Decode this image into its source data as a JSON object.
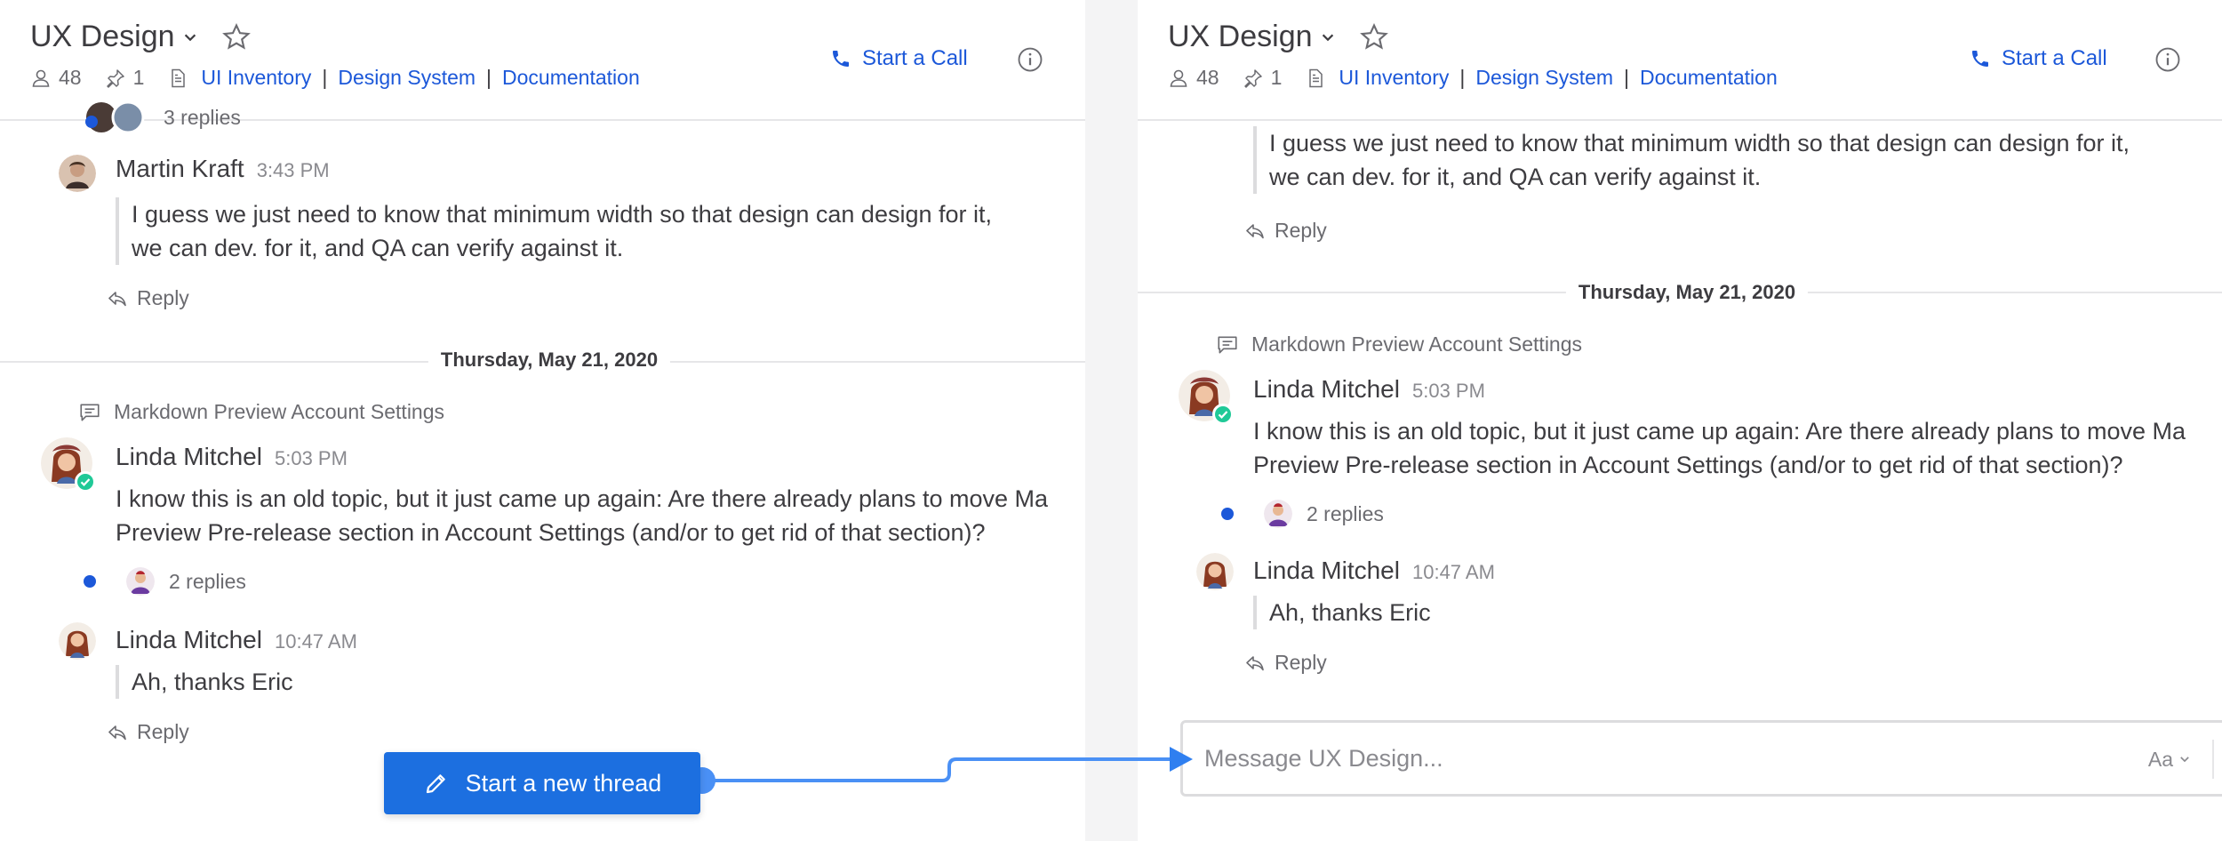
{
  "channel": {
    "name": "UX Design",
    "members_count": "48",
    "pinned_count": "1",
    "links": [
      "UI Inventory",
      "Design System",
      "Documentation"
    ],
    "call_label": "Start a Call"
  },
  "left": {
    "prev_replies": "3 replies",
    "martin": {
      "author": "Martin Kraft",
      "time": "3:43 PM",
      "line1": "I guess we just need to know that minimum width so that design can design for it,",
      "line2": "we can dev. for it, and QA can verify against it.",
      "reply": "Reply"
    },
    "date": "Thursday, May 21, 2020",
    "thread_hint": "Markdown Preview Account Settings",
    "linda1": {
      "author": "Linda Mitchel",
      "time": "5:03 PM",
      "line1": "I know this is an old topic, but it just came up again: Are there already plans to move Ma",
      "line2": "Preview Pre-release section in Account Settings (and/or to get rid of that section)?"
    },
    "replies": "2 replies",
    "linda2": {
      "author": "Linda Mitchel",
      "time": "10:47 AM",
      "text": "Ah, thanks Eric",
      "reply": "Reply"
    },
    "new_thread_label": "Start a new thread"
  },
  "right": {
    "quote_line1": "I guess we just need to know that minimum width so that design can design for it,",
    "quote_line2": "we can dev. for it, and QA can verify against it.",
    "reply": "Reply",
    "date": "Thursday, May 21, 2020",
    "thread_hint": "Markdown Preview Account Settings",
    "linda1": {
      "author": "Linda Mitchel",
      "time": "5:03 PM",
      "line1": "I know this is an old topic, but it just came up again: Are there already plans to move Ma",
      "line2": "Preview Pre-release section in Account Settings (and/or to get rid of that section)?"
    },
    "replies": "2 replies",
    "linda2": {
      "author": "Linda Mitchel",
      "time": "10:47 AM",
      "text": "Ah, thanks Eric",
      "reply": "Reply"
    },
    "composer": {
      "placeholder": "Message UX Design...",
      "format_label": "Aa"
    }
  },
  "colors": {
    "accent": "#1c58d9",
    "button": "#1c6fe0",
    "connector": "#4a90f5",
    "online": "#20c997"
  }
}
